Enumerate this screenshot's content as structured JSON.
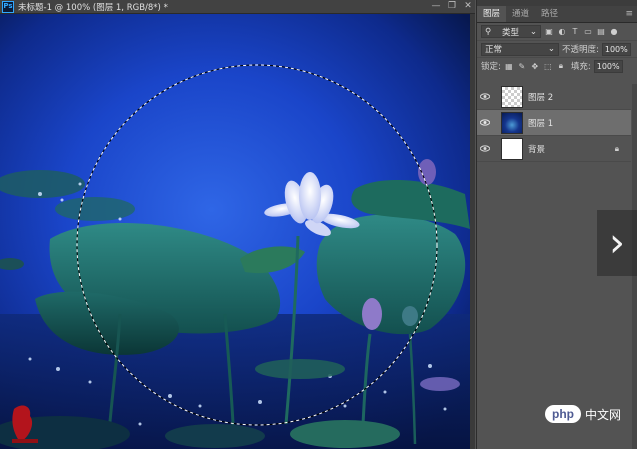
{
  "document": {
    "app_icon": "Ps",
    "title": "未标题-1 @ 100% (图层 1, RGB/8*) *",
    "window_buttons": [
      "—",
      "❐",
      "✕"
    ]
  },
  "panel": {
    "tabs": [
      {
        "label": "图层",
        "active": true
      },
      {
        "label": "通道",
        "active": false
      },
      {
        "label": "路径",
        "active": false
      }
    ],
    "menu_icon": "≡",
    "filter": {
      "kind_label": "类型",
      "icons": [
        "image-filter-icon",
        "adjustment-filter-icon",
        "type-filter-icon",
        "shape-filter-icon",
        "smart-object-filter-icon"
      ]
    },
    "blend_mode": "正常",
    "opacity_label": "不透明度:",
    "opacity_value": "100%",
    "lock_label": "锁定:",
    "fill_label": "填充:",
    "fill_value": "100%",
    "layers": [
      {
        "name": "图层 2",
        "thumb": "checker",
        "visible": true,
        "selected": false,
        "locked": false
      },
      {
        "name": "图层 1",
        "thumb": "photo",
        "visible": true,
        "selected": true,
        "locked": false
      },
      {
        "name": "背景",
        "thumb": "white",
        "visible": true,
        "selected": false,
        "locked": true
      }
    ]
  },
  "overlay": {
    "next_arrow": "›",
    "watermark_php": "php",
    "watermark_cn": "中文网"
  },
  "colors": {
    "ui_bg": "#535353",
    "selected_layer": "#6e6e6e",
    "ps_blue": "#31a8ff"
  }
}
